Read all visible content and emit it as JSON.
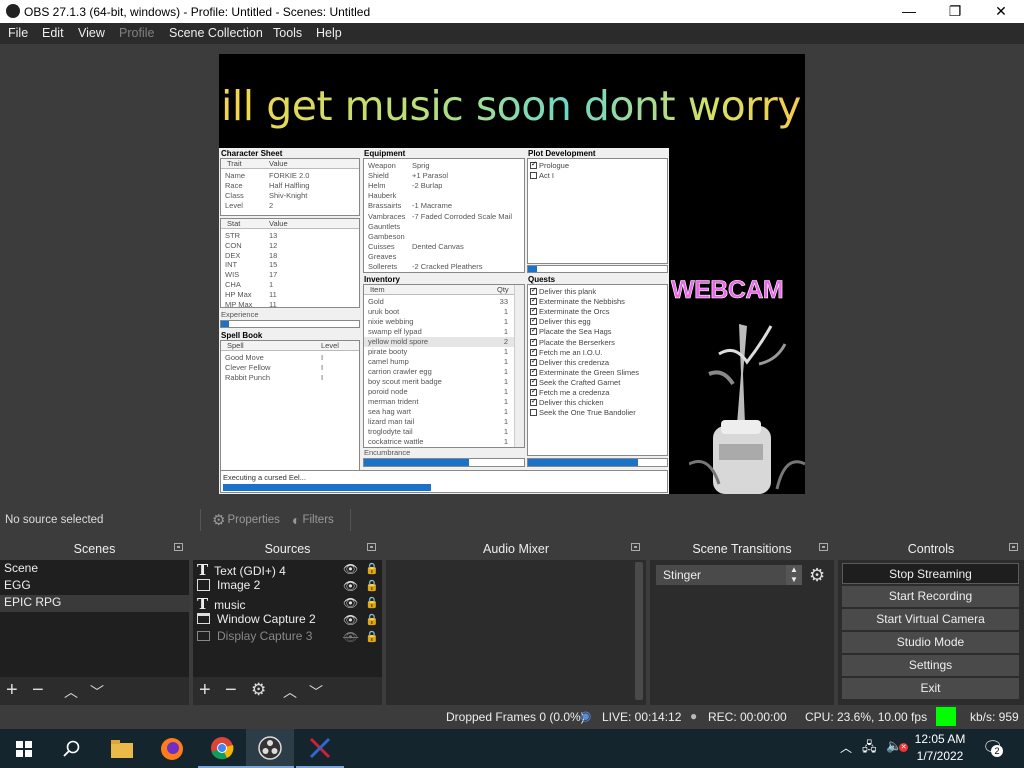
{
  "window": {
    "title": "OBS 27.1.3 (64-bit, windows) - Profile: Untitled - Scenes: Untitled",
    "minimize": "—",
    "maximize": "❐",
    "close": "✕"
  },
  "menu": [
    "File",
    "Edit",
    "View",
    "Profile",
    "Scene Collection",
    "Tools",
    "Help"
  ],
  "preview": {
    "overlay_text": "ill get music soon dont worry",
    "webcam_label": "WEBCAM",
    "game": {
      "character_sheet": {
        "title": "Character Sheet",
        "columns": [
          "Trait",
          "Value"
        ],
        "traits": [
          [
            "Name",
            "FORKIE 2.0"
          ],
          [
            "Race",
            "Half Halfling"
          ],
          [
            "Class",
            "Shiv-Knight"
          ],
          [
            "Level",
            "2"
          ]
        ],
        "stat_columns": [
          "Stat",
          "Value"
        ],
        "stats": [
          [
            "STR",
            "13"
          ],
          [
            "CON",
            "12"
          ],
          [
            "DEX",
            "18"
          ],
          [
            "INT",
            "15"
          ],
          [
            "WIS",
            "17"
          ],
          [
            "CHA",
            "1"
          ],
          [
            "HP Max",
            "11"
          ],
          [
            "MP Max",
            "11"
          ]
        ],
        "experience_label": "Experience"
      },
      "spell_book": {
        "title": "Spell Book",
        "columns": [
          "Spell",
          "Level"
        ],
        "spells": [
          [
            "Good Move",
            "I"
          ],
          [
            "Clever Fellow",
            "I"
          ],
          [
            "Rabbit Punch",
            "I"
          ]
        ]
      },
      "equipment": {
        "title": "Equipment",
        "items": [
          [
            "Weapon",
            "Sprig"
          ],
          [
            "Shield",
            "+1 Parasol"
          ],
          [
            "Helm",
            "-2 Burlap"
          ],
          [
            "Hauberk",
            ""
          ],
          [
            "Brassairts",
            "-1 Macrame"
          ],
          [
            "Vambraces",
            "-7 Faded Corroded Scale Mail"
          ],
          [
            "Gauntlets",
            ""
          ],
          [
            "Gambeson",
            ""
          ],
          [
            "Cuisses",
            "Dented Canvas"
          ],
          [
            "Greaves",
            ""
          ],
          [
            "Sollerets",
            "-2 Cracked Pleathers"
          ]
        ]
      },
      "inventory": {
        "title": "Inventory",
        "columns": [
          "Item",
          "Qty"
        ],
        "items": [
          [
            "Gold",
            "33"
          ],
          [
            "uruk boot",
            "1"
          ],
          [
            "nixie webbing",
            "1"
          ],
          [
            "swamp elf lypad",
            "1"
          ],
          [
            "yellow mold spore",
            "2"
          ],
          [
            "pirate booty",
            "1"
          ],
          [
            "camel hump",
            "1"
          ],
          [
            "carrion crawler egg",
            "1"
          ],
          [
            "boy scout merit badge",
            "1"
          ],
          [
            "poroid node",
            "1"
          ],
          [
            "merman trident",
            "1"
          ],
          [
            "sea hag wart",
            "1"
          ],
          [
            "lizard man tail",
            "1"
          ],
          [
            "troglodyte tail",
            "1"
          ],
          [
            "cockatrice wattle",
            "1"
          ]
        ],
        "encumbrance_label": "Encumbrance"
      },
      "plot": {
        "title": "Plot Development",
        "items": [
          {
            "label": "Prologue",
            "checked": true
          },
          {
            "label": "Act I",
            "checked": false
          }
        ]
      },
      "quests": {
        "title": "Quests",
        "items": [
          {
            "label": "Deliver this plank",
            "checked": true
          },
          {
            "label": "Exterminate the Nebbishs",
            "checked": true
          },
          {
            "label": "Exterminate the Orcs",
            "checked": true
          },
          {
            "label": "Deliver this egg",
            "checked": true
          },
          {
            "label": "Placate the Sea Hags",
            "checked": true
          },
          {
            "label": "Placate the Berserkers",
            "checked": true
          },
          {
            "label": "Fetch me an I.O.U.",
            "checked": true
          },
          {
            "label": "Deliver this credenza",
            "checked": true
          },
          {
            "label": "Exterminate the Green Slimes",
            "checked": true
          },
          {
            "label": "Seek the Crafted Garnet",
            "checked": true
          },
          {
            "label": "Fetch me a credenza",
            "checked": true
          },
          {
            "label": "Deliver this chicken",
            "checked": true
          },
          {
            "label": "Seek the One True Bandolier",
            "checked": false
          }
        ]
      },
      "status_text": "Executing a cursed Eel..."
    }
  },
  "source_toolbar": {
    "no_source": "No source selected",
    "properties": "Properties",
    "filters": "Filters"
  },
  "scenes": {
    "title": "Scenes",
    "items": [
      "Scene",
      "EGG",
      "EPIC RPG"
    ]
  },
  "sources": {
    "title": "Sources",
    "items": [
      {
        "name": "Text (GDI+) 4",
        "icon": "text-icon",
        "visible": true
      },
      {
        "name": "Image 2",
        "icon": "image-icon",
        "visible": true
      },
      {
        "name": "music",
        "icon": "text-icon",
        "visible": true
      },
      {
        "name": "Window Capture 2",
        "icon": "window-icon",
        "visible": true
      },
      {
        "name": "Display Capture 3",
        "icon": "monitor-icon",
        "visible": false
      }
    ]
  },
  "audio_mixer": {
    "title": "Audio Mixer"
  },
  "scene_transitions": {
    "title": "Scene Transitions",
    "selected": "Stinger"
  },
  "controls": {
    "title": "Controls",
    "buttons": [
      "Stop Streaming",
      "Start Recording",
      "Start Virtual Camera",
      "Studio Mode",
      "Settings",
      "Exit"
    ]
  },
  "status": {
    "dropped_frames": "Dropped Frames 0 (0.0%)",
    "live": "LIVE: 00:14:12",
    "rec": "REC: 00:00:00",
    "cpu": "CPU: 23.6%, 10.00 fps",
    "kbs": "kb/s: 959",
    "indicator_color": "#00ff00"
  },
  "taskbar": {
    "time": "12:05 AM",
    "date": "1/7/2022",
    "notifications": "2"
  }
}
